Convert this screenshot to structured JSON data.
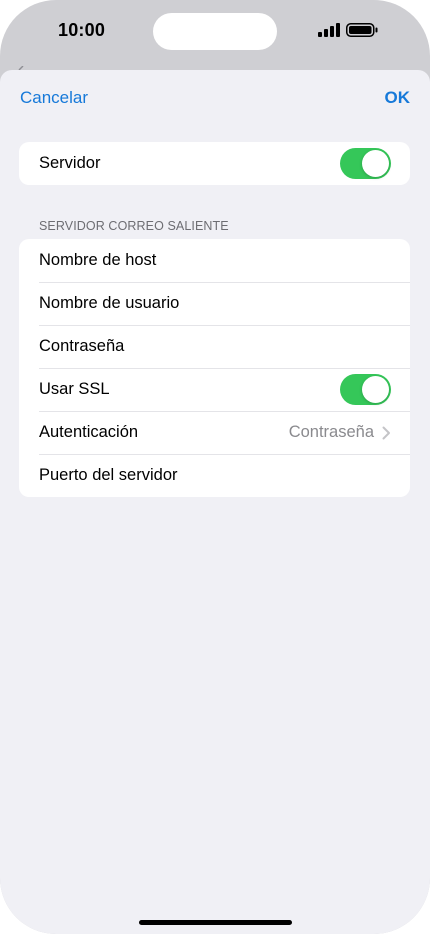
{
  "status_bar": {
    "time": "10:00",
    "icons": [
      "signal-icon",
      "battery-icon"
    ]
  },
  "nav": {
    "cancel_label": "Cancelar",
    "ok_label": "OK"
  },
  "server_group": {
    "label": "Servidor",
    "toggle_on": true
  },
  "outgoing_section": {
    "header": "SERVIDOR CORREO SALIENTE",
    "rows": [
      {
        "label": "Nombre de host"
      },
      {
        "label": "Nombre de usuario"
      },
      {
        "label": "Contraseña"
      },
      {
        "label": "Usar SSL",
        "toggle_on": true
      },
      {
        "label": "Autenticación",
        "value": "Contraseña",
        "icon": "chevron-right-icon"
      },
      {
        "label": "Puerto del servidor"
      }
    ]
  },
  "colors": {
    "accent": "#1679d9",
    "toggle_on": "#35c759",
    "background": "#f0f0f5"
  }
}
